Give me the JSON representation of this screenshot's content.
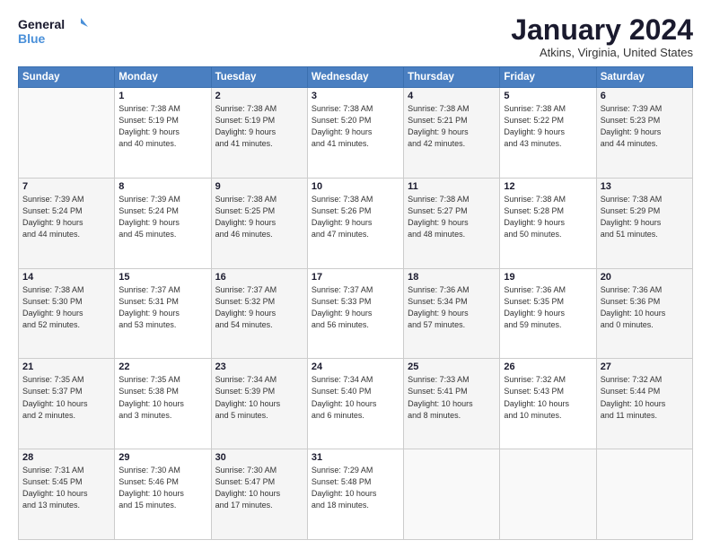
{
  "logo": {
    "line1": "General",
    "line2": "Blue"
  },
  "title": "January 2024",
  "subtitle": "Atkins, Virginia, United States",
  "days_header": [
    "Sunday",
    "Monday",
    "Tuesday",
    "Wednesday",
    "Thursday",
    "Friday",
    "Saturday"
  ],
  "weeks": [
    [
      {
        "day": "",
        "info": ""
      },
      {
        "day": "1",
        "info": "Sunrise: 7:38 AM\nSunset: 5:19 PM\nDaylight: 9 hours\nand 40 minutes."
      },
      {
        "day": "2",
        "info": "Sunrise: 7:38 AM\nSunset: 5:19 PM\nDaylight: 9 hours\nand 41 minutes."
      },
      {
        "day": "3",
        "info": "Sunrise: 7:38 AM\nSunset: 5:20 PM\nDaylight: 9 hours\nand 41 minutes."
      },
      {
        "day": "4",
        "info": "Sunrise: 7:38 AM\nSunset: 5:21 PM\nDaylight: 9 hours\nand 42 minutes."
      },
      {
        "day": "5",
        "info": "Sunrise: 7:38 AM\nSunset: 5:22 PM\nDaylight: 9 hours\nand 43 minutes."
      },
      {
        "day": "6",
        "info": "Sunrise: 7:39 AM\nSunset: 5:23 PM\nDaylight: 9 hours\nand 44 minutes."
      }
    ],
    [
      {
        "day": "7",
        "info": "Sunrise: 7:39 AM\nSunset: 5:24 PM\nDaylight: 9 hours\nand 44 minutes."
      },
      {
        "day": "8",
        "info": "Sunrise: 7:39 AM\nSunset: 5:24 PM\nDaylight: 9 hours\nand 45 minutes."
      },
      {
        "day": "9",
        "info": "Sunrise: 7:38 AM\nSunset: 5:25 PM\nDaylight: 9 hours\nand 46 minutes."
      },
      {
        "day": "10",
        "info": "Sunrise: 7:38 AM\nSunset: 5:26 PM\nDaylight: 9 hours\nand 47 minutes."
      },
      {
        "day": "11",
        "info": "Sunrise: 7:38 AM\nSunset: 5:27 PM\nDaylight: 9 hours\nand 48 minutes."
      },
      {
        "day": "12",
        "info": "Sunrise: 7:38 AM\nSunset: 5:28 PM\nDaylight: 9 hours\nand 50 minutes."
      },
      {
        "day": "13",
        "info": "Sunrise: 7:38 AM\nSunset: 5:29 PM\nDaylight: 9 hours\nand 51 minutes."
      }
    ],
    [
      {
        "day": "14",
        "info": "Sunrise: 7:38 AM\nSunset: 5:30 PM\nDaylight: 9 hours\nand 52 minutes."
      },
      {
        "day": "15",
        "info": "Sunrise: 7:37 AM\nSunset: 5:31 PM\nDaylight: 9 hours\nand 53 minutes."
      },
      {
        "day": "16",
        "info": "Sunrise: 7:37 AM\nSunset: 5:32 PM\nDaylight: 9 hours\nand 54 minutes."
      },
      {
        "day": "17",
        "info": "Sunrise: 7:37 AM\nSunset: 5:33 PM\nDaylight: 9 hours\nand 56 minutes."
      },
      {
        "day": "18",
        "info": "Sunrise: 7:36 AM\nSunset: 5:34 PM\nDaylight: 9 hours\nand 57 minutes."
      },
      {
        "day": "19",
        "info": "Sunrise: 7:36 AM\nSunset: 5:35 PM\nDaylight: 9 hours\nand 59 minutes."
      },
      {
        "day": "20",
        "info": "Sunrise: 7:36 AM\nSunset: 5:36 PM\nDaylight: 10 hours\nand 0 minutes."
      }
    ],
    [
      {
        "day": "21",
        "info": "Sunrise: 7:35 AM\nSunset: 5:37 PM\nDaylight: 10 hours\nand 2 minutes."
      },
      {
        "day": "22",
        "info": "Sunrise: 7:35 AM\nSunset: 5:38 PM\nDaylight: 10 hours\nand 3 minutes."
      },
      {
        "day": "23",
        "info": "Sunrise: 7:34 AM\nSunset: 5:39 PM\nDaylight: 10 hours\nand 5 minutes."
      },
      {
        "day": "24",
        "info": "Sunrise: 7:34 AM\nSunset: 5:40 PM\nDaylight: 10 hours\nand 6 minutes."
      },
      {
        "day": "25",
        "info": "Sunrise: 7:33 AM\nSunset: 5:41 PM\nDaylight: 10 hours\nand 8 minutes."
      },
      {
        "day": "26",
        "info": "Sunrise: 7:32 AM\nSunset: 5:43 PM\nDaylight: 10 hours\nand 10 minutes."
      },
      {
        "day": "27",
        "info": "Sunrise: 7:32 AM\nSunset: 5:44 PM\nDaylight: 10 hours\nand 11 minutes."
      }
    ],
    [
      {
        "day": "28",
        "info": "Sunrise: 7:31 AM\nSunset: 5:45 PM\nDaylight: 10 hours\nand 13 minutes."
      },
      {
        "day": "29",
        "info": "Sunrise: 7:30 AM\nSunset: 5:46 PM\nDaylight: 10 hours\nand 15 minutes."
      },
      {
        "day": "30",
        "info": "Sunrise: 7:30 AM\nSunset: 5:47 PM\nDaylight: 10 hours\nand 17 minutes."
      },
      {
        "day": "31",
        "info": "Sunrise: 7:29 AM\nSunset: 5:48 PM\nDaylight: 10 hours\nand 18 minutes."
      },
      {
        "day": "",
        "info": ""
      },
      {
        "day": "",
        "info": ""
      },
      {
        "day": "",
        "info": ""
      }
    ]
  ]
}
